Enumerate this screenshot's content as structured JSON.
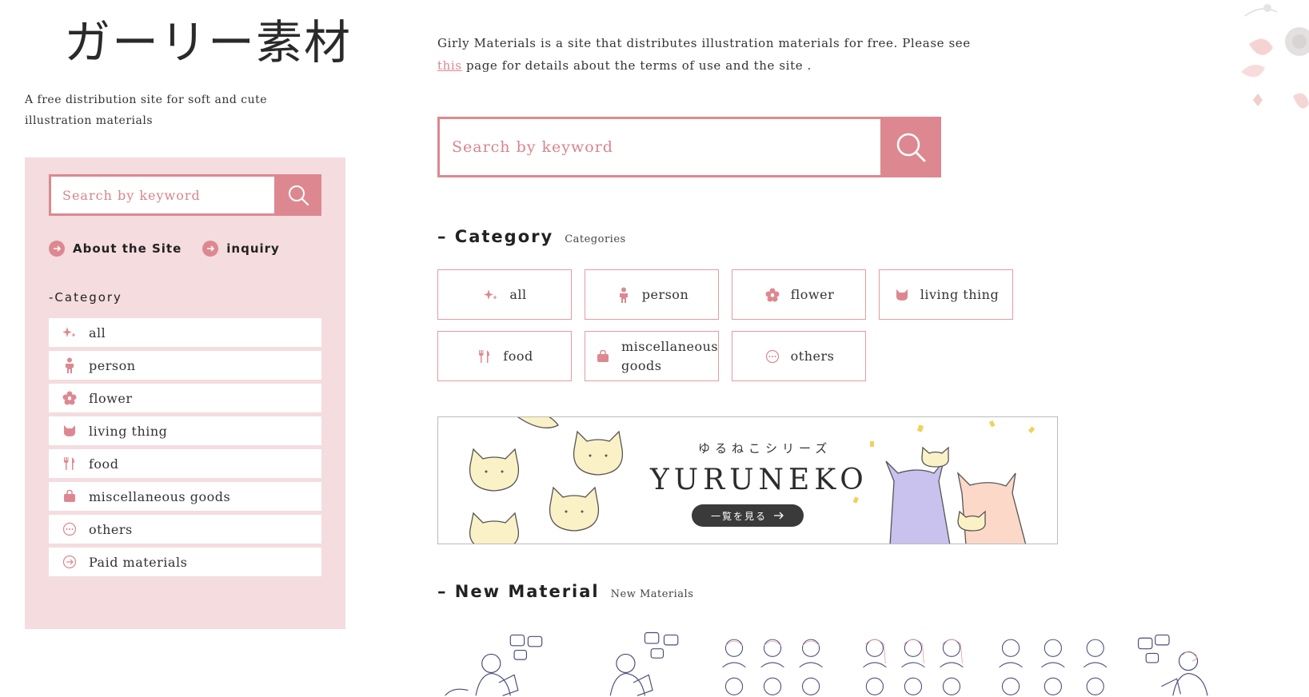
{
  "site": {
    "logo": "ガーリー素材",
    "tagline": "A free distribution site for soft and cute illustration materials"
  },
  "sidebar": {
    "search": {
      "placeholder": "Search by keyword"
    },
    "links": [
      {
        "label": "About the Site"
      },
      {
        "label": "inquiry"
      }
    ],
    "category_heading": "-Category",
    "items": [
      {
        "label": "all",
        "icon": "sparkle-icon"
      },
      {
        "label": "person",
        "icon": "person-icon"
      },
      {
        "label": "flower",
        "icon": "flower-icon"
      },
      {
        "label": "living thing",
        "icon": "cat-icon"
      },
      {
        "label": "food",
        "icon": "cutlery-icon"
      },
      {
        "label": "miscellaneous goods",
        "icon": "bag-icon"
      },
      {
        "label": "others",
        "icon": "dots-icon"
      },
      {
        "label": "Paid materials",
        "icon": "arrow-circle-icon"
      }
    ]
  },
  "intro": {
    "text_before": "Girly Materials is a site that distributes illustration materials for free. Please see ",
    "link": "this",
    "text_after": " page for details about the terms of use and the site ."
  },
  "main_search": {
    "placeholder": "Search by keyword"
  },
  "category_section": {
    "heading": "– Category",
    "subheading": "Categories",
    "items": [
      {
        "label": "all",
        "icon": "sparkle-icon"
      },
      {
        "label": "person",
        "icon": "person-icon"
      },
      {
        "label": "flower",
        "icon": "flower-icon"
      },
      {
        "label": "living thing",
        "icon": "cat-icon"
      },
      {
        "label": "food",
        "icon": "cutlery-icon"
      },
      {
        "label": "miscellaneous goods",
        "icon": "bag-icon"
      },
      {
        "label": "others",
        "icon": "dots-icon"
      }
    ]
  },
  "banner": {
    "subtitle": "ゆるねこシリーズ",
    "title": "YURUNEKO",
    "button": "一覧を見る"
  },
  "new_section": {
    "heading": "– New Material",
    "subheading": "New Materials"
  },
  "colors": {
    "accent": "#dd8890",
    "panel": "#f4dcdf",
    "border": "#e69aa1",
    "text": "#333333"
  }
}
